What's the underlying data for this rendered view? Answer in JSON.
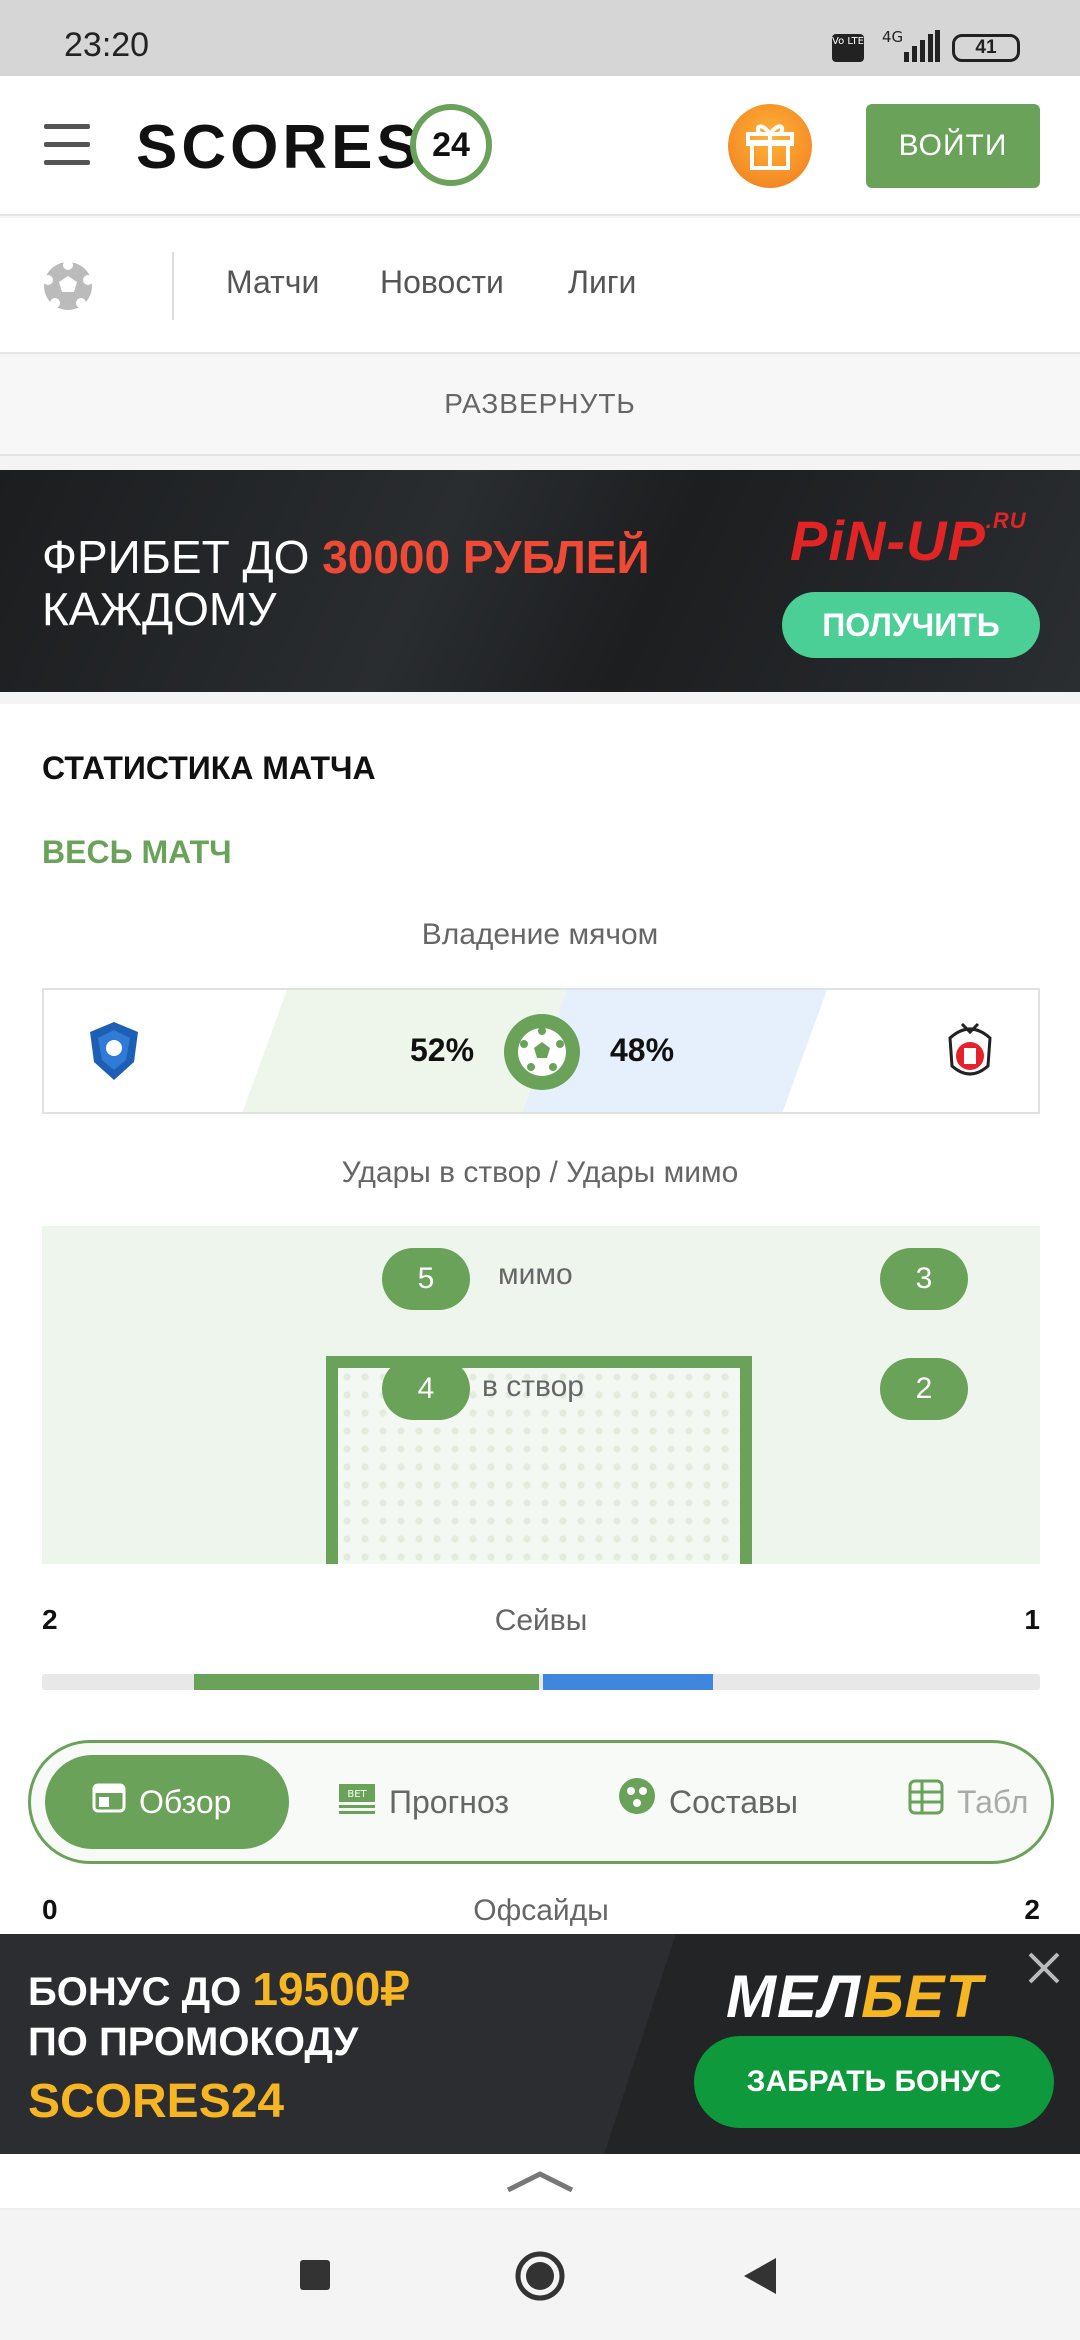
{
  "status_bar": {
    "time": "23:20",
    "network": "4G",
    "volte": "Vo LTE",
    "battery": "41"
  },
  "header": {
    "logo_text": "SCORES",
    "logo_badge": "24",
    "login_label": "ВОЙТИ"
  },
  "sport_nav": {
    "links": [
      "Матчи",
      "Новости",
      "Лиги"
    ]
  },
  "expand_label": "РАЗВЕРНУТЬ",
  "promo_pinup": {
    "line1_prefix": "ФРИБЕТ ДО",
    "line1_highlight": "30000 РУБЛЕЙ",
    "line2": "КАЖДОМУ",
    "brand": "PiN-UP",
    "brand_suffix": ".RU",
    "cta": "ПОЛУЧИТЬ"
  },
  "stats": {
    "title": "СТАТИСТИКА МАТЧА",
    "period": "ВЕСЬ МАТЧ",
    "possession": {
      "label": "Владение мячом",
      "home": "52%",
      "away": "48%"
    },
    "shots": {
      "label": "Удары в створ / Удары мимо",
      "home_off": "5",
      "away_off": "3",
      "off_label": "мимо",
      "home_on": "4",
      "away_on": "2",
      "on_label": "в створ"
    },
    "saves": {
      "label": "Сейвы",
      "home": "2",
      "away": "1",
      "home_fraction": 0.67,
      "away_fraction": 0.33
    },
    "offsides": {
      "label": "Офсайды",
      "home": "0",
      "away": "2"
    }
  },
  "tabs": [
    "Обзор",
    "Прогноз",
    "Составы",
    "Табл"
  ],
  "promo_melbet": {
    "line1_prefix": "БОНУС ДО",
    "line1_highlight": "19500₽",
    "line2": "ПО ПРОМОКОДУ",
    "line3": "SCORES24",
    "brand_white": "МЕЛ",
    "brand_yellow": "БЕТ",
    "cta": "ЗАБРАТЬ БОНУС"
  },
  "colors": {
    "accent": "#6aa25a",
    "away": "#3f87de",
    "promo_red": "#ef4a35",
    "promo_yellow": "#f6b522"
  }
}
